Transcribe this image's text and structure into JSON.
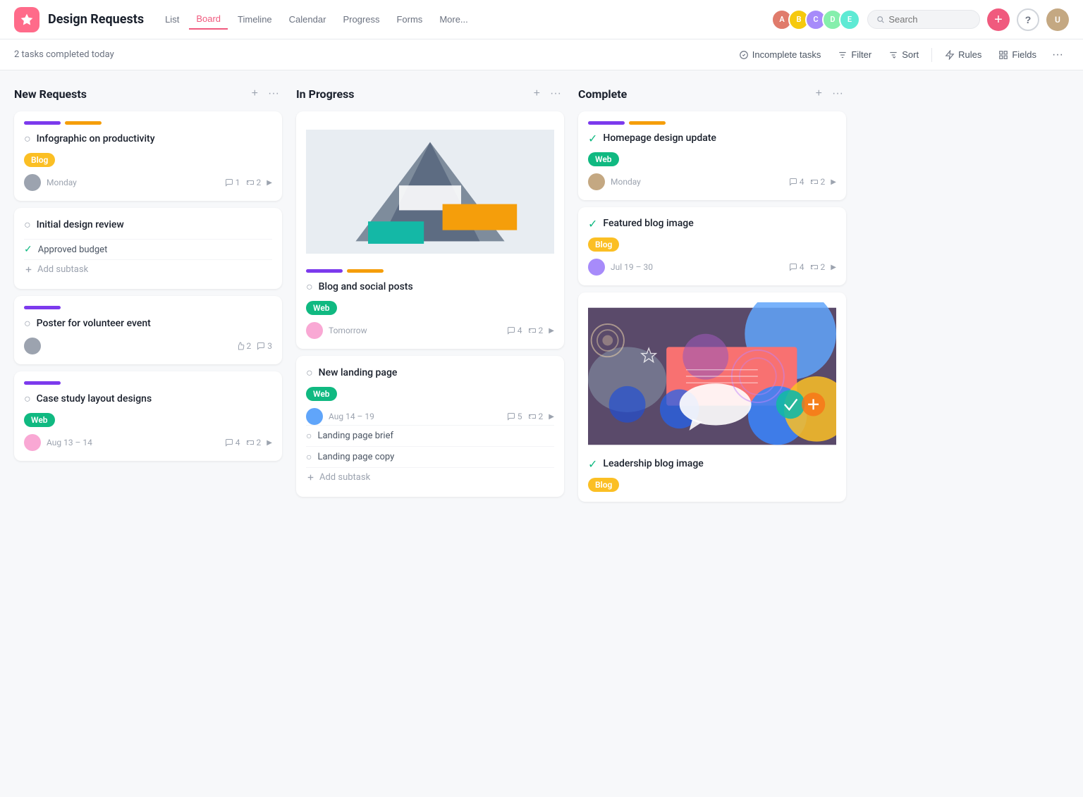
{
  "header": {
    "app_title": "Design Requests",
    "nav_tabs": [
      {
        "label": "List",
        "active": false
      },
      {
        "label": "Board",
        "active": true
      },
      {
        "label": "Timeline",
        "active": false
      },
      {
        "label": "Calendar",
        "active": false
      },
      {
        "label": "Progress",
        "active": false
      },
      {
        "label": "Forms",
        "active": false
      },
      {
        "label": "More...",
        "active": false
      }
    ],
    "search_placeholder": "Search",
    "help_label": "?"
  },
  "toolbar": {
    "status_text": "2 tasks completed today",
    "incomplete_tasks_label": "Incomplete tasks",
    "filter_label": "Filter",
    "sort_label": "Sort",
    "rules_label": "Rules",
    "fields_label": "Fields"
  },
  "columns": [
    {
      "id": "new-requests",
      "title": "New Requests",
      "cards": [
        {
          "id": "card-infographic",
          "tags": [
            "purple",
            "yellow"
          ],
          "title": "Infographic on productivity",
          "badge": "Blog",
          "badge_type": "blog",
          "avatar_color": "gray",
          "date": "Monday",
          "comments": "1",
          "subtasks": "2",
          "has_chevron": true
        },
        {
          "id": "card-initial-design",
          "title": "Initial design review",
          "subtask_items": [
            {
              "label": "Approved budget",
              "complete": true
            }
          ],
          "has_add_subtask": true,
          "add_subtask_label": "Add subtask"
        },
        {
          "id": "card-poster",
          "tags": [
            "purple"
          ],
          "title": "Poster for volunteer event",
          "avatar_color": "gray",
          "date": "",
          "likes": "2",
          "comments": "3"
        },
        {
          "id": "card-case-study",
          "tags": [
            "purple"
          ],
          "title": "Case study layout designs",
          "badge": "Web",
          "badge_type": "web",
          "avatar_color": "pink",
          "date": "Aug 13 – 14",
          "comments": "4",
          "subtasks": "2",
          "has_chevron": true
        }
      ]
    },
    {
      "id": "in-progress",
      "title": "In Progress",
      "cards": [
        {
          "id": "card-blog-social",
          "has_image": true,
          "tags": [
            "purple",
            "yellow"
          ],
          "title": "Blog and social posts",
          "badge": "Web",
          "badge_type": "web",
          "avatar_color": "pink",
          "date": "Tomorrow",
          "comments": "4",
          "subtasks": "2",
          "has_chevron": true
        },
        {
          "id": "card-landing-page",
          "title": "New landing page",
          "badge": "Web",
          "badge_type": "web",
          "avatar_color": "blue",
          "date": "Aug 14 – 19",
          "comments": "5",
          "subtasks": "2",
          "has_chevron": true,
          "subtask_items": [
            {
              "label": "Landing page brief",
              "complete": false
            },
            {
              "label": "Landing page copy",
              "complete": false
            }
          ],
          "has_add_subtask": true,
          "add_subtask_label": "Add subtask"
        }
      ]
    },
    {
      "id": "complete",
      "title": "Complete",
      "cards": [
        {
          "id": "card-homepage",
          "tags": [
            "purple",
            "yellow"
          ],
          "title": "Homepage design update",
          "badge": "Web",
          "badge_type": "web",
          "complete": true,
          "avatar_color": "pink",
          "date": "Monday",
          "comments": "4",
          "subtasks": "2",
          "has_chevron": true
        },
        {
          "id": "card-featured-blog",
          "title": "Featured blog image",
          "badge": "Blog",
          "badge_type": "blog",
          "complete": true,
          "avatar_color": "gray",
          "date": "Jul 19 – 30",
          "comments": "4",
          "subtasks": "2",
          "has_chevron": true
        },
        {
          "id": "card-leadership",
          "has_image": true,
          "image_type": "colorful",
          "title": "Leadership blog image",
          "badge": "Blog",
          "badge_type": "blog",
          "complete": true
        }
      ]
    }
  ]
}
